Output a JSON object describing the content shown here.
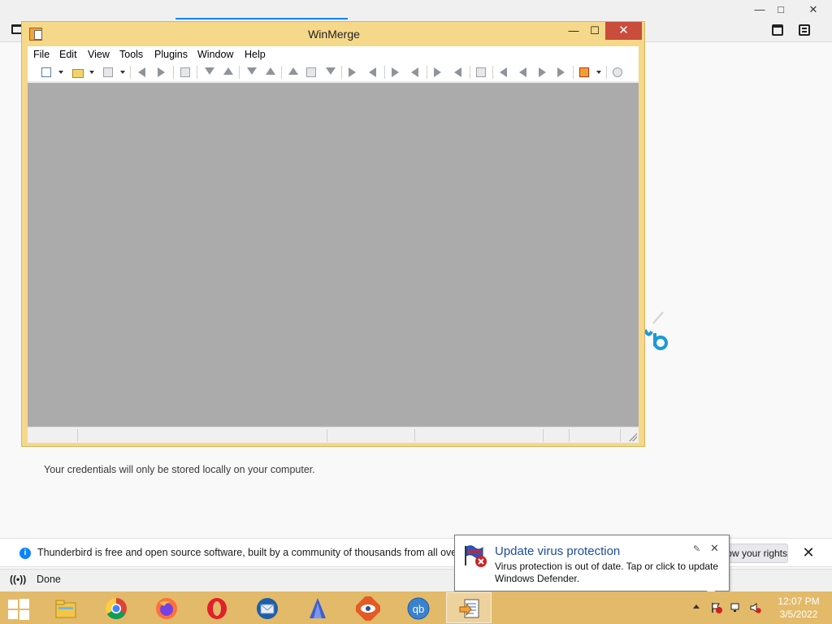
{
  "thunderbird": {
    "window_min": "—",
    "window_max": "□",
    "window_close": "✕",
    "credentials_note": "Your credentials will only be stored locally on your computer.",
    "notification_text": "Thunderbird is free and open source software, built by a community of thousands from all over the world.",
    "rights_button_label": "Know your rights...",
    "notification_close": "✕",
    "status_icon_glyph": "((•))",
    "status_text": "Done"
  },
  "winmerge": {
    "title": "WinMerge",
    "controls": {
      "minimize": "—",
      "maximize": "☐",
      "close": "✕"
    },
    "menu": [
      "File",
      "Edit",
      "View",
      "Tools",
      "Plugins",
      "Window",
      "Help"
    ]
  },
  "defender_balloon": {
    "title": "Update virus protection",
    "message": "Virus protection is out of date. Tap or click to update Windows Defender.",
    "settings_glyph": "✎",
    "close_glyph": "✕"
  },
  "taskbar": {
    "apps": [
      {
        "icon": "file-explorer-icon"
      },
      {
        "icon": "chrome-icon"
      },
      {
        "icon": "firefox-icon"
      },
      {
        "icon": "opera-icon"
      },
      {
        "icon": "thunderbird-icon"
      },
      {
        "icon": "app-blue-icon"
      },
      {
        "icon": "eye-app-icon"
      },
      {
        "icon": "qbittorrent-icon",
        "label": "qb"
      },
      {
        "icon": "winmerge-icon",
        "active": true
      }
    ],
    "clock": {
      "time": "12:07 PM",
      "date": "3/5/2022"
    }
  },
  "colors": {
    "taskbar": "#e3ba6a",
    "winmerge_frame": "#f6d88a",
    "close_red": "#c94c3c",
    "link_blue": "#0a84ff",
    "defender_title": "#1e4ba0"
  }
}
